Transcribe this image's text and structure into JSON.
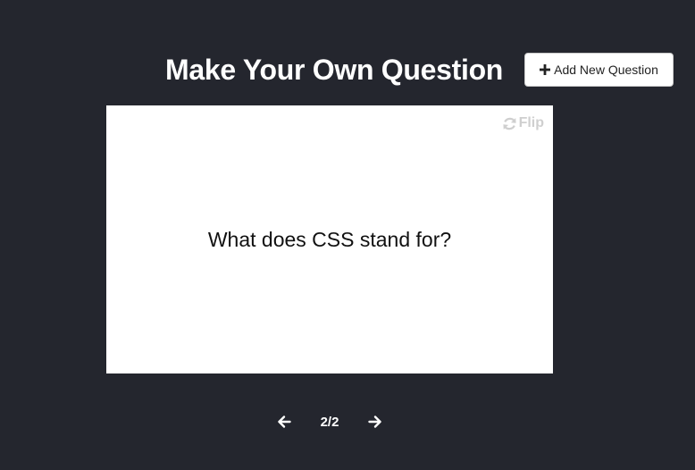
{
  "header": {
    "title": "Make Your Own Question",
    "add_button_label": "Add New Question",
    "add_button_icon": "plus-icon"
  },
  "card": {
    "flip_label": "Flip",
    "flip_icon": "sync-icon",
    "question": "What does CSS stand for?"
  },
  "navigation": {
    "prev_icon": "arrow-left-icon",
    "next_icon": "arrow-right-icon",
    "counter": "2/2"
  },
  "colors": {
    "background": "#24262e",
    "card": "#ffffff",
    "flip_text": "#cfcfcf"
  }
}
